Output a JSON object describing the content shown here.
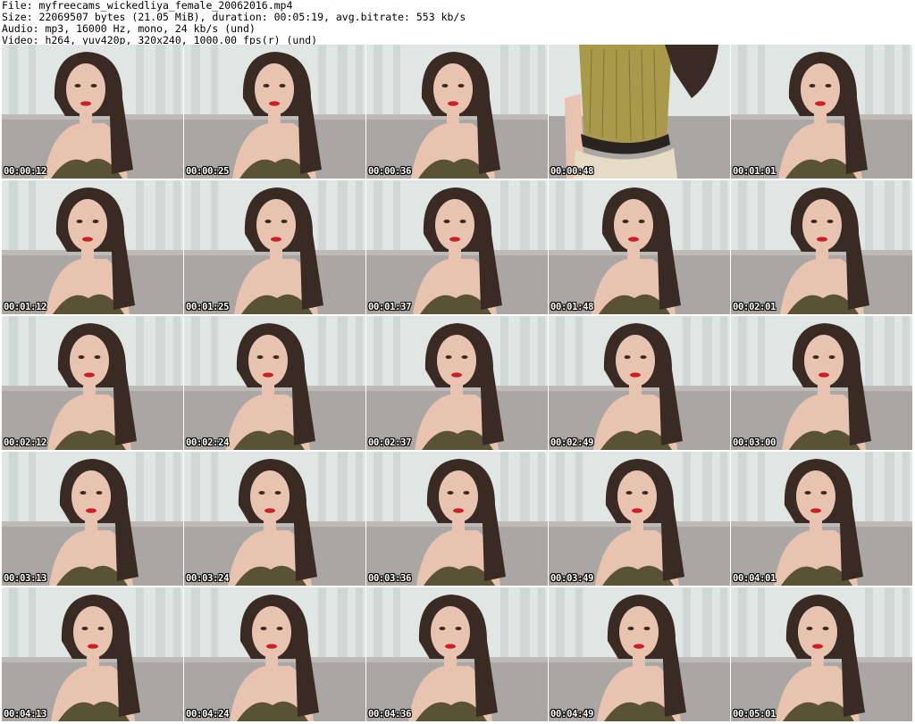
{
  "header": {
    "file_line": "File: myfreecams_wickedliya_female_20062016.mp4",
    "size_line": "Size: 22069507 bytes (21.05 MiB), duration: 00:05:19, avg.bitrate: 553 kb/s",
    "audio_line": "Audio: mp3, 16000 Hz, mono, 24 kb/s (und)",
    "video_line": "Video: h264, yuv420p, 320x240, 1000.00 fps(r) (und)"
  },
  "thumbnails": [
    {
      "timestamp": "00:00:12",
      "variant": "face"
    },
    {
      "timestamp": "00:00:25",
      "variant": "face"
    },
    {
      "timestamp": "00:00:36",
      "variant": "face"
    },
    {
      "timestamp": "00:00:48",
      "variant": "torso"
    },
    {
      "timestamp": "00:01:01",
      "variant": "face"
    },
    {
      "timestamp": "00:01:12",
      "variant": "face"
    },
    {
      "timestamp": "00:01:25",
      "variant": "face"
    },
    {
      "timestamp": "00:01:37",
      "variant": "face"
    },
    {
      "timestamp": "00:01:48",
      "variant": "face"
    },
    {
      "timestamp": "00:02:01",
      "variant": "face"
    },
    {
      "timestamp": "00:02:12",
      "variant": "face"
    },
    {
      "timestamp": "00:02:24",
      "variant": "face"
    },
    {
      "timestamp": "00:02:37",
      "variant": "face"
    },
    {
      "timestamp": "00:02:49",
      "variant": "face"
    },
    {
      "timestamp": "00:03:00",
      "variant": "face"
    },
    {
      "timestamp": "00:03:13",
      "variant": "face"
    },
    {
      "timestamp": "00:03:24",
      "variant": "face"
    },
    {
      "timestamp": "00:03:36",
      "variant": "face"
    },
    {
      "timestamp": "00:03:49",
      "variant": "face"
    },
    {
      "timestamp": "00:04:01",
      "variant": "face"
    },
    {
      "timestamp": "00:04:13",
      "variant": "face"
    },
    {
      "timestamp": "00:04:24",
      "variant": "face"
    },
    {
      "timestamp": "00:04:36",
      "variant": "face"
    },
    {
      "timestamp": "00:04:49",
      "variant": "face"
    },
    {
      "timestamp": "00:05:01",
      "variant": "face"
    }
  ],
  "colors": {
    "curtain": "#dfe6e4",
    "curtain_fold": "#c9d3d1",
    "sofa": "#a9a6a4",
    "skin": "#e8c3b0",
    "hair": "#3a2a24",
    "lips": "#cc1f2a",
    "top": "#5a5236",
    "gold_top": "#a89a4a"
  }
}
